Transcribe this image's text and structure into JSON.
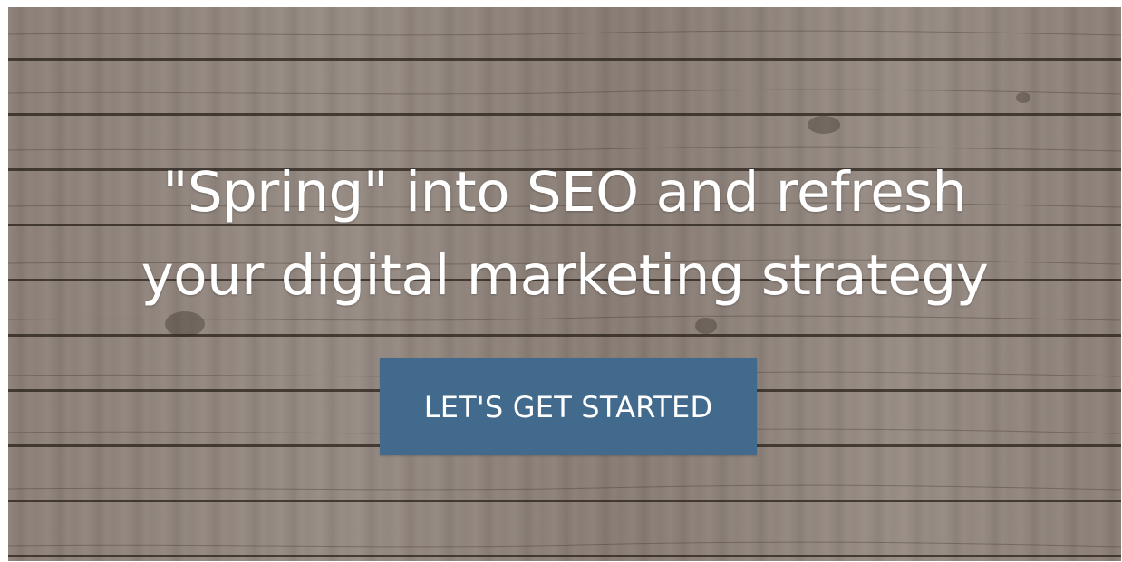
{
  "hero": {
    "headline_line1": "\"Spring\" into SEO and refresh",
    "headline_line2": "your digital marketing strategy",
    "background_style": "wood-planks",
    "colors": {
      "text": "#ffffff",
      "button_bg": "#426a8c",
      "wood": "#8d8179"
    }
  },
  "cta": {
    "label": "LET'S GET STARTED"
  }
}
